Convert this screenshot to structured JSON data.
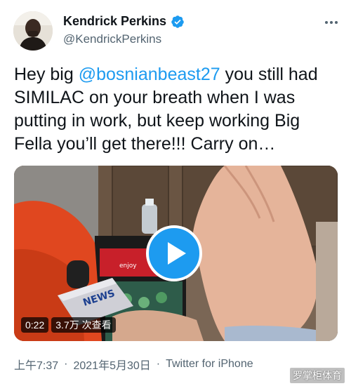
{
  "author": {
    "display_name": "Kendrick Perkins",
    "handle": "@KendrickPerkins",
    "verified": true,
    "avatar_icon": "profile-avatar"
  },
  "more_icon": "more-horizontal-icon",
  "tweet": {
    "text_part1": "Hey big ",
    "mention": "@bosnianbeast27",
    "text_part2": " you still had SIMILAC on your breath when I was putting in work, but keep working Big Fella you’ll get there!!! Carry on…"
  },
  "media": {
    "type": "video",
    "duration": "0:22",
    "views": "3.7万 次查看",
    "play_icon": "play-icon",
    "mic_logo_text": "NEWS",
    "fridge_brand": "enjoy"
  },
  "meta": {
    "time": "上午7:37",
    "separator": "·",
    "date": "2021年5月30日",
    "source": "Twitter for iPhone"
  },
  "watermark": "罗掌柜体育",
  "colors": {
    "accent": "#1d9bf0",
    "text_primary": "#0f1419",
    "text_secondary": "#536471"
  }
}
